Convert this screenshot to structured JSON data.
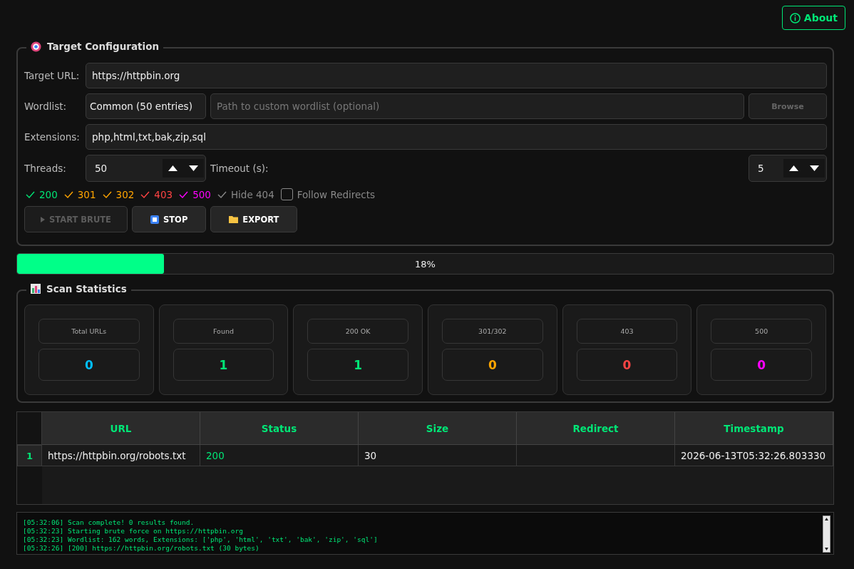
{
  "about_button": {
    "label": "About"
  },
  "target_configuration": {
    "title": "Target Configuration",
    "target_url": {
      "label": "Target URL:",
      "value": "https://httpbin.org"
    },
    "wordlist": {
      "label": "Wordlist:",
      "value": "Common (50 entries)",
      "path_placeholder": "Path to custom wordlist (optional)",
      "browse_button": {
        "label": "Browse",
        "disabled": true
      }
    },
    "extensions": {
      "label": "Extensions:",
      "value": "php,html,txt,bak,zip,sql"
    },
    "threads": {
      "label": "Threads:",
      "value": "50"
    },
    "timeout": {
      "label": "Timeout (s):",
      "value": "5"
    },
    "filters": [
      {
        "label": "200",
        "checked": true,
        "color": "#00e676"
      },
      {
        "label": "301",
        "checked": true,
        "color": "#ffa500"
      },
      {
        "label": "302",
        "checked": true,
        "color": "#ffa500"
      },
      {
        "label": "403",
        "checked": true,
        "color": "#ff4444"
      },
      {
        "label": "500",
        "checked": true,
        "color": "#ff00ff"
      },
      {
        "label": "Hide 404",
        "checked": true,
        "color": "#888888"
      },
      {
        "label": "Follow Redirects",
        "checked": false,
        "color": "#888888"
      }
    ],
    "buttons": [
      {
        "kind": "start",
        "label": "START BRUTE",
        "disabled": true
      },
      {
        "kind": "stop",
        "label": "STOP",
        "disabled": false
      },
      {
        "kind": "export",
        "label": "EXPORT",
        "disabled": false
      }
    ]
  },
  "progress": {
    "level": 0.18,
    "reading": "18%"
  },
  "scan_statistics": {
    "title": "Scan Statistics",
    "cards": [
      {
        "label": "Total URLs",
        "value": "0",
        "color": "#00bfff"
      },
      {
        "label": "Found",
        "value": "1",
        "color": "#00e676"
      },
      {
        "label": "200 OK",
        "value": "1",
        "color": "#00e676"
      },
      {
        "label": "301/302",
        "value": "0",
        "color": "#ffa500"
      },
      {
        "label": "403",
        "value": "0",
        "color": "#ff4444"
      },
      {
        "label": "500",
        "value": "0",
        "color": "#ff00ff"
      }
    ]
  },
  "results_table": {
    "columns": [
      "URL",
      "Status",
      "Size",
      "Redirect",
      "Timestamp"
    ],
    "rows": [
      {
        "number": "1",
        "url": "https://httpbin.org/robots.txt",
        "status": "200",
        "size": "30",
        "redirect": "",
        "timestamp": "2026-06-13T05:32:26.803330"
      }
    ]
  },
  "log": [
    "[05:32:06] Scan complete! 0 results found.",
    "[05:32:23] Starting brute force on https://httpbin.org",
    "[05:32:23] Wordlist: 162 words, Extensions: ['php', 'html', 'txt', 'bak', 'zip', 'sql']",
    "[05:32:26] [200] https://httpbin.org/robots.txt (30 bytes)"
  ]
}
